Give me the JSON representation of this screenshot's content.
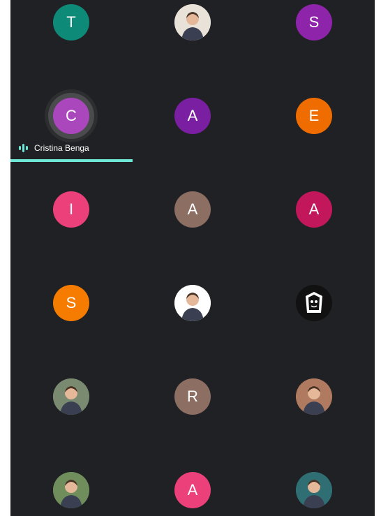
{
  "participants": [
    {
      "initial": "T",
      "color": "#0e8a78",
      "photo": false
    },
    {
      "initial": "",
      "color": "#e9e2d8",
      "photo": true,
      "icon": "profile-photo-1"
    },
    {
      "initial": "S",
      "color": "#8e24aa",
      "photo": false
    },
    {
      "initial": "C",
      "color": "#ab47bc",
      "photo": false,
      "speaking": true,
      "name": "Cristina Benga"
    },
    {
      "initial": "A",
      "color": "#7b1fa2",
      "photo": false
    },
    {
      "initial": "E",
      "color": "#ef6c00",
      "photo": false
    },
    {
      "initial": "I",
      "color": "#ec407a",
      "photo": false
    },
    {
      "initial": "A",
      "color": "#8d6e63",
      "photo": false
    },
    {
      "initial": "A",
      "color": "#c2185b",
      "photo": false
    },
    {
      "initial": "S",
      "color": "#f57c00",
      "photo": false
    },
    {
      "initial": "",
      "color": "#ffffff",
      "photo": true,
      "icon": "profile-photo-2"
    },
    {
      "initial": "",
      "color": "#111111",
      "photo": true,
      "icon": "pharaoh-logo"
    },
    {
      "initial": "",
      "color": "#7a8a70",
      "photo": true,
      "icon": "profile-photo-3"
    },
    {
      "initial": "R",
      "color": "#8d6e63",
      "photo": false
    },
    {
      "initial": "",
      "color": "#b07a60",
      "photo": true,
      "icon": "profile-photo-4"
    },
    {
      "initial": "",
      "color": "#6f8e5c",
      "photo": true,
      "icon": "profile-photo-5"
    },
    {
      "initial": "A",
      "color": "#ec407a",
      "photo": false
    },
    {
      "initial": "",
      "color": "#2f6f74",
      "photo": true,
      "icon": "profile-photo-6"
    }
  ],
  "speaker": {
    "name": "Cristina Benga",
    "indicator_color": "#6ee7d6"
  }
}
